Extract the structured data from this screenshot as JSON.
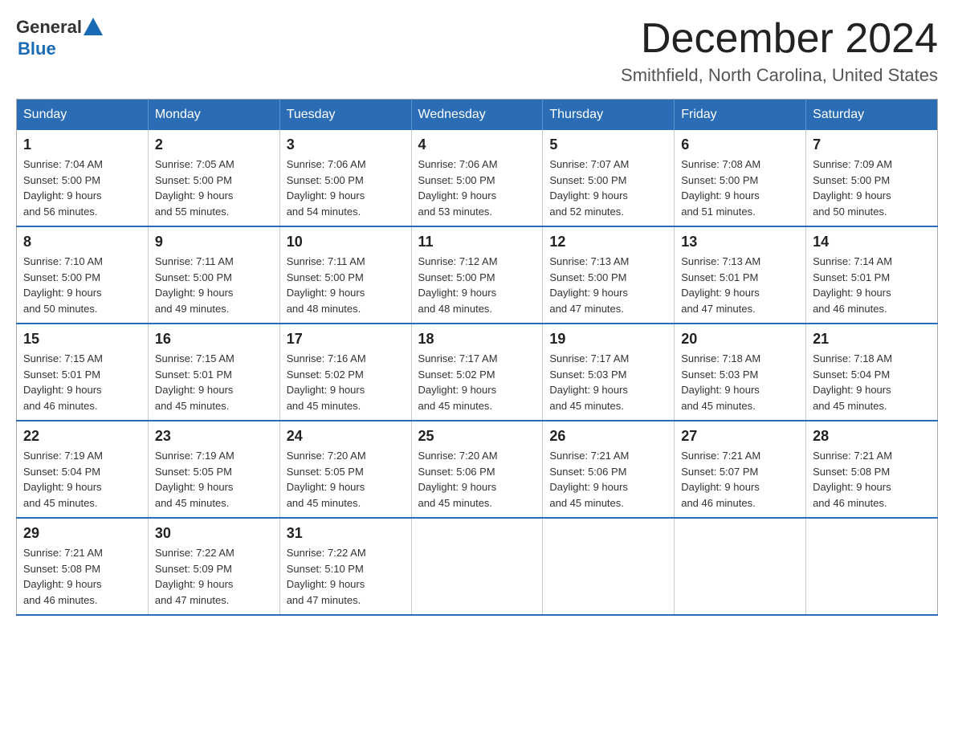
{
  "header": {
    "logo_general": "General",
    "logo_blue": "Blue",
    "month_title": "December 2024",
    "location": "Smithfield, North Carolina, United States"
  },
  "days_of_week": [
    "Sunday",
    "Monday",
    "Tuesday",
    "Wednesday",
    "Thursday",
    "Friday",
    "Saturday"
  ],
  "weeks": [
    [
      {
        "day": "1",
        "sunrise": "7:04 AM",
        "sunset": "5:00 PM",
        "daylight": "9 hours and 56 minutes."
      },
      {
        "day": "2",
        "sunrise": "7:05 AM",
        "sunset": "5:00 PM",
        "daylight": "9 hours and 55 minutes."
      },
      {
        "day": "3",
        "sunrise": "7:06 AM",
        "sunset": "5:00 PM",
        "daylight": "9 hours and 54 minutes."
      },
      {
        "day": "4",
        "sunrise": "7:06 AM",
        "sunset": "5:00 PM",
        "daylight": "9 hours and 53 minutes."
      },
      {
        "day": "5",
        "sunrise": "7:07 AM",
        "sunset": "5:00 PM",
        "daylight": "9 hours and 52 minutes."
      },
      {
        "day": "6",
        "sunrise": "7:08 AM",
        "sunset": "5:00 PM",
        "daylight": "9 hours and 51 minutes."
      },
      {
        "day": "7",
        "sunrise": "7:09 AM",
        "sunset": "5:00 PM",
        "daylight": "9 hours and 50 minutes."
      }
    ],
    [
      {
        "day": "8",
        "sunrise": "7:10 AM",
        "sunset": "5:00 PM",
        "daylight": "9 hours and 50 minutes."
      },
      {
        "day": "9",
        "sunrise": "7:11 AM",
        "sunset": "5:00 PM",
        "daylight": "9 hours and 49 minutes."
      },
      {
        "day": "10",
        "sunrise": "7:11 AM",
        "sunset": "5:00 PM",
        "daylight": "9 hours and 48 minutes."
      },
      {
        "day": "11",
        "sunrise": "7:12 AM",
        "sunset": "5:00 PM",
        "daylight": "9 hours and 48 minutes."
      },
      {
        "day": "12",
        "sunrise": "7:13 AM",
        "sunset": "5:00 PM",
        "daylight": "9 hours and 47 minutes."
      },
      {
        "day": "13",
        "sunrise": "7:13 AM",
        "sunset": "5:01 PM",
        "daylight": "9 hours and 47 minutes."
      },
      {
        "day": "14",
        "sunrise": "7:14 AM",
        "sunset": "5:01 PM",
        "daylight": "9 hours and 46 minutes."
      }
    ],
    [
      {
        "day": "15",
        "sunrise": "7:15 AM",
        "sunset": "5:01 PM",
        "daylight": "9 hours and 46 minutes."
      },
      {
        "day": "16",
        "sunrise": "7:15 AM",
        "sunset": "5:01 PM",
        "daylight": "9 hours and 45 minutes."
      },
      {
        "day": "17",
        "sunrise": "7:16 AM",
        "sunset": "5:02 PM",
        "daylight": "9 hours and 45 minutes."
      },
      {
        "day": "18",
        "sunrise": "7:17 AM",
        "sunset": "5:02 PM",
        "daylight": "9 hours and 45 minutes."
      },
      {
        "day": "19",
        "sunrise": "7:17 AM",
        "sunset": "5:03 PM",
        "daylight": "9 hours and 45 minutes."
      },
      {
        "day": "20",
        "sunrise": "7:18 AM",
        "sunset": "5:03 PM",
        "daylight": "9 hours and 45 minutes."
      },
      {
        "day": "21",
        "sunrise": "7:18 AM",
        "sunset": "5:04 PM",
        "daylight": "9 hours and 45 minutes."
      }
    ],
    [
      {
        "day": "22",
        "sunrise": "7:19 AM",
        "sunset": "5:04 PM",
        "daylight": "9 hours and 45 minutes."
      },
      {
        "day": "23",
        "sunrise": "7:19 AM",
        "sunset": "5:05 PM",
        "daylight": "9 hours and 45 minutes."
      },
      {
        "day": "24",
        "sunrise": "7:20 AM",
        "sunset": "5:05 PM",
        "daylight": "9 hours and 45 minutes."
      },
      {
        "day": "25",
        "sunrise": "7:20 AM",
        "sunset": "5:06 PM",
        "daylight": "9 hours and 45 minutes."
      },
      {
        "day": "26",
        "sunrise": "7:21 AM",
        "sunset": "5:06 PM",
        "daylight": "9 hours and 45 minutes."
      },
      {
        "day": "27",
        "sunrise": "7:21 AM",
        "sunset": "5:07 PM",
        "daylight": "9 hours and 46 minutes."
      },
      {
        "day": "28",
        "sunrise": "7:21 AM",
        "sunset": "5:08 PM",
        "daylight": "9 hours and 46 minutes."
      }
    ],
    [
      {
        "day": "29",
        "sunrise": "7:21 AM",
        "sunset": "5:08 PM",
        "daylight": "9 hours and 46 minutes."
      },
      {
        "day": "30",
        "sunrise": "7:22 AM",
        "sunset": "5:09 PM",
        "daylight": "9 hours and 47 minutes."
      },
      {
        "day": "31",
        "sunrise": "7:22 AM",
        "sunset": "5:10 PM",
        "daylight": "9 hours and 47 minutes."
      },
      null,
      null,
      null,
      null
    ]
  ],
  "labels": {
    "sunrise_prefix": "Sunrise: ",
    "sunset_prefix": "Sunset: ",
    "daylight_prefix": "Daylight: "
  }
}
